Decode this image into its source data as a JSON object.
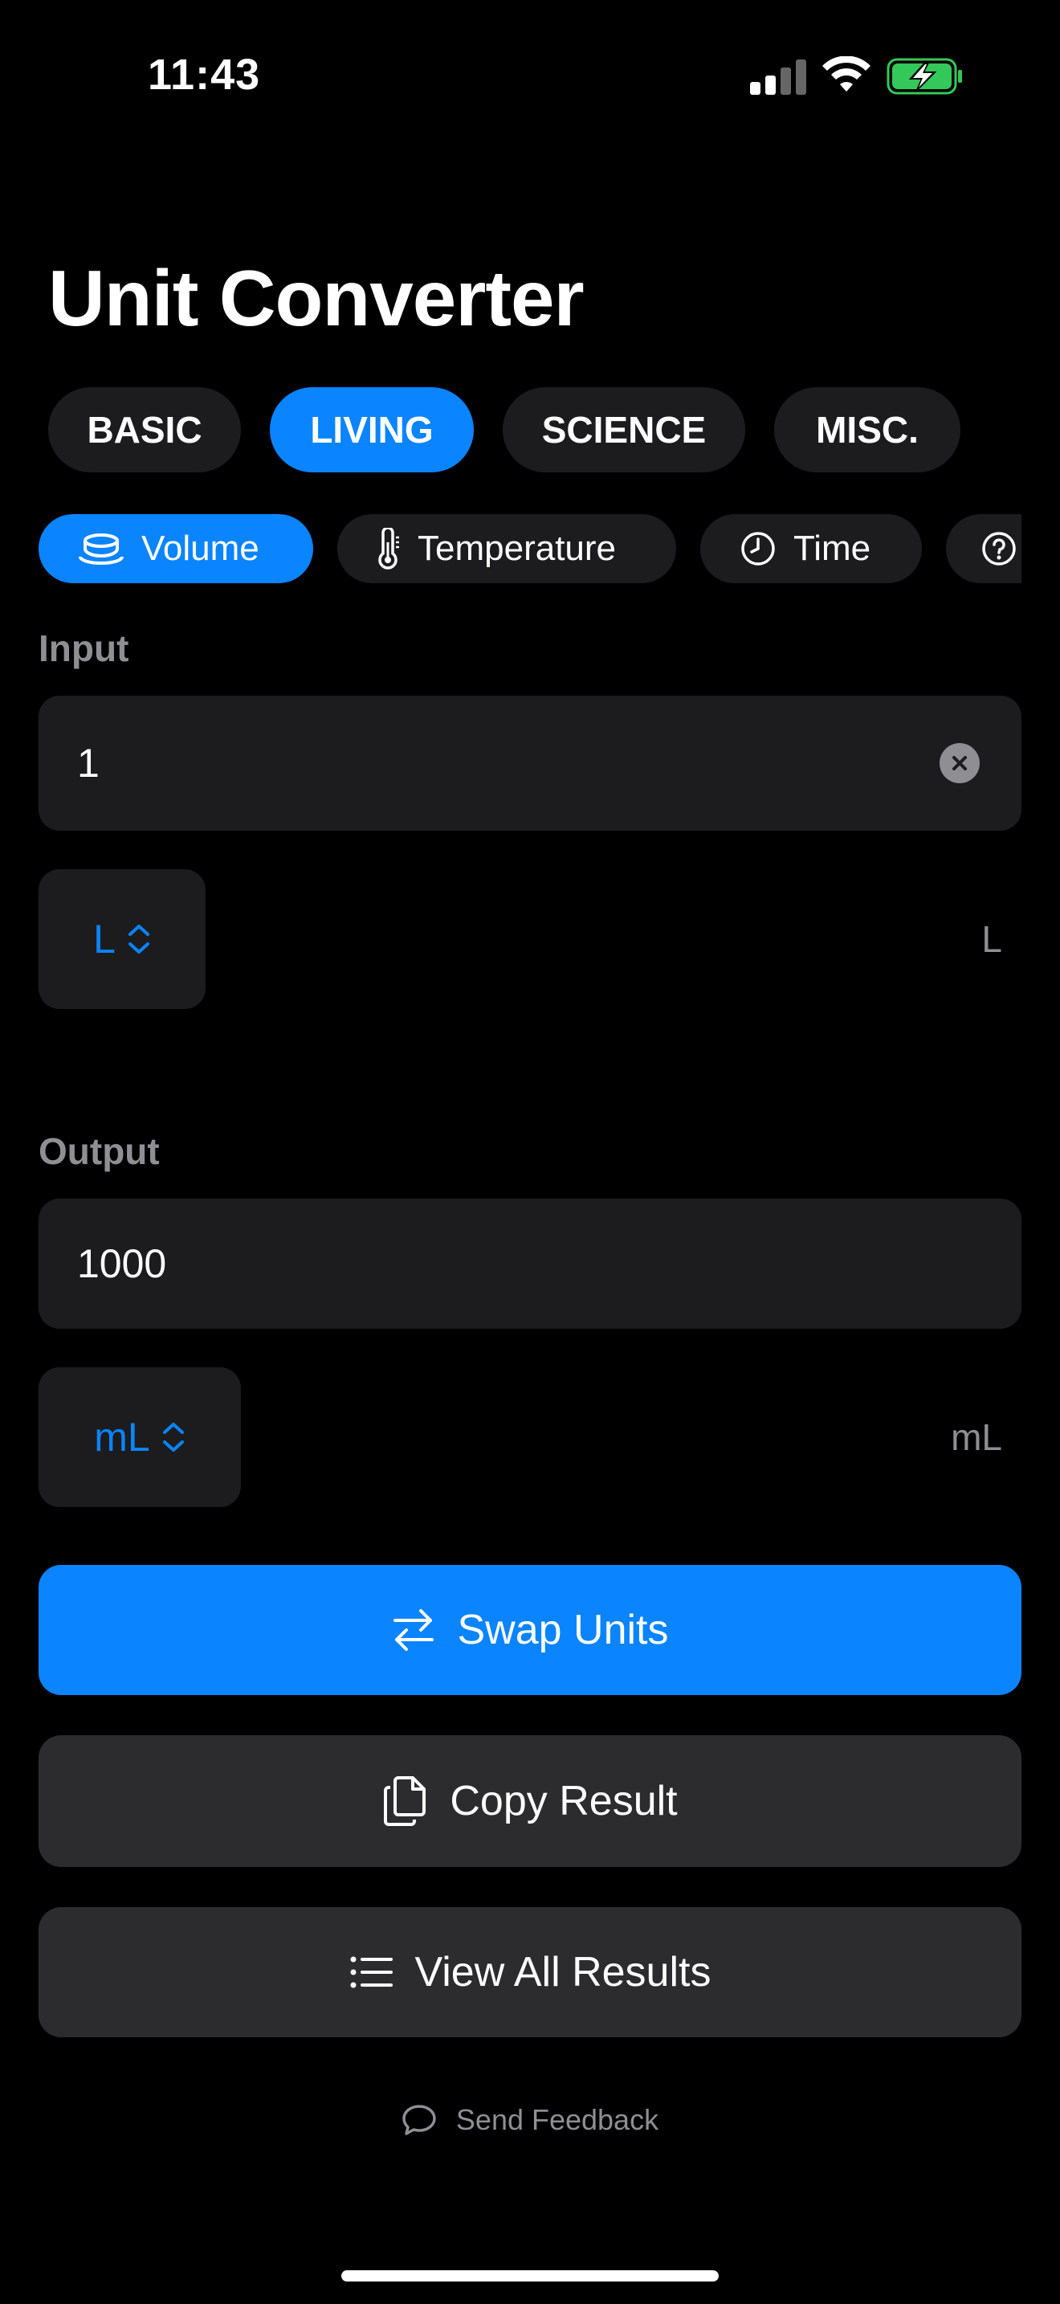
{
  "status_bar": {
    "time": "11:43"
  },
  "title": "Unit Converter",
  "categories": [
    {
      "label": "BASIC",
      "active": false
    },
    {
      "label": "LIVING",
      "active": true
    },
    {
      "label": "SCIENCE",
      "active": false
    },
    {
      "label": "MISC.",
      "active": false
    }
  ],
  "sub_tabs": [
    {
      "label": "Volume",
      "icon": "cup-icon",
      "active": true
    },
    {
      "label": "Temperature",
      "icon": "thermometer-icon",
      "active": false
    },
    {
      "label": "Time",
      "icon": "clock-icon",
      "active": false
    },
    {
      "label": "",
      "icon": "question-icon",
      "active": false
    }
  ],
  "input": {
    "label": "Input",
    "value": "1",
    "unit_picker": "L",
    "unit_tag": "L"
  },
  "output": {
    "label": "Output",
    "value": "1000",
    "unit_picker": "mL",
    "unit_tag": "mL"
  },
  "actions": {
    "swap": "Swap Units",
    "copy": "Copy Result",
    "view_all": "View All Results"
  },
  "feedback": "Send Feedback",
  "colors": {
    "accent": "#0a84ff",
    "surface": "#1c1c1e",
    "secondary_button": "#2c2c2e",
    "muted": "#8e8e93",
    "battery": "#34c759"
  }
}
